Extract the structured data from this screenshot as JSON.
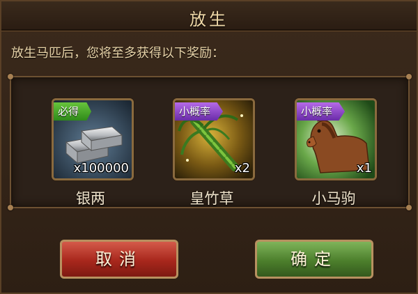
{
  "dialog": {
    "title": "放生",
    "description": "放生马匹后，您将至多获得以下奖励："
  },
  "rewards": [
    {
      "tag": "必得",
      "tag_color": "#4aa82a",
      "quantity": "x100000",
      "name": "银两",
      "icon": "silver-ingot-icon"
    },
    {
      "tag": "小概率",
      "tag_color": "#8a45c8",
      "quantity": "x2",
      "name": "皇竹草",
      "icon": "bamboo-grass-icon"
    },
    {
      "tag": "小概率",
      "tag_color": "#8a45c8",
      "quantity": "x1",
      "name": "小马驹",
      "icon": "pony-icon"
    }
  ],
  "buttons": {
    "cancel_label": "取消",
    "confirm_label": "确定"
  },
  "colors": {
    "cancel_button": "#b8352a",
    "confirm_button": "#4f7f2e",
    "text_gold": "#e8d3a8"
  }
}
